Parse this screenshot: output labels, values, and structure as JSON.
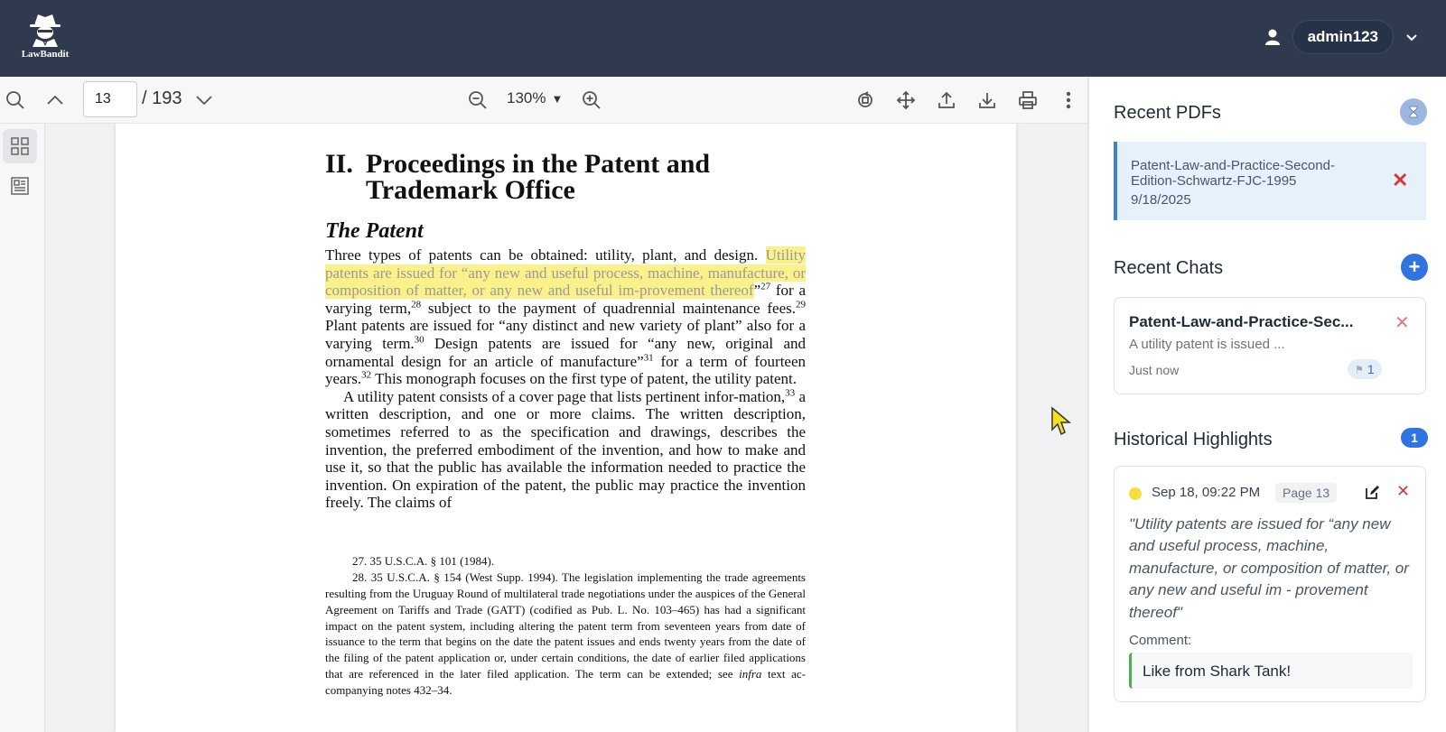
{
  "app": {
    "logo_text": "LawBandit",
    "username": "admin123"
  },
  "toolbar": {
    "page_value": "13",
    "page_total": "/ 193",
    "zoom": "130%"
  },
  "document": {
    "chapter_num": "II.",
    "chapter_line1": "Proceedings in the Patent and",
    "chapter_line2": "Trademark Office",
    "section": "The Patent",
    "p1_a": "Three types of patents can be obtained: utility, plant, and design.",
    "p1_hl": "Utility patents are issued for “any new and useful process, machine, manufacture, or composition of matter, or any new and useful im-provement thereof",
    "p1_b": "”",
    "p1_s27": "27",
    "p1_c": " for a varying term,",
    "p1_s28": "28",
    "p1_d": " subject to the payment of quadrennial maintenance fees.",
    "p1_s29": "29",
    "p1_e": " Plant patents are issued for “any distinct and new variety of plant” also for a varying term.",
    "p1_s30": "30",
    "p1_f": " Design patents are issued for “any new, original and ornamental design for an article of manufacture”",
    "p1_s31": "31",
    "p1_g": " for a term of fourteen years.",
    "p1_s32": "32",
    "p1_h": " This monograph focuses on the first type of patent, the utility patent.",
    "p2_a": "A utility patent consists of a cover page that lists pertinent infor-mation,",
    "p2_s33": "33",
    "p2_b": " a written description, and one or more claims. The written description, sometimes referred to as the specification and drawings, describes the invention, the preferred embodiment of the invention, and how to make and use it, so that the public has available the information needed to practice the invention. On expiration of the patent, the public may practice the invention freely. The claims of",
    "fn27": "27. 35 U.S.C.A. § 101 (1984).",
    "fn28": "28. 35 U.S.C.A. § 154 (West Supp. 1994). The legislation implementing the trade agreements resulting from the Uruguay Round of multilateral trade negotiations under the auspices of the General Agreement on Tariffs and Trade (GATT) (codified as Pub. L. No. 103–465) has had a significant impact on the patent system, including altering the patent term from seventeen years from date of issuance to the term that begins on the date the patent issues and ends twenty years from the date of the filing of the patent application or, under certain conditions, the date of earlier filed applications that are referenced in the later filed application. The term can be extended; see",
    "fn28_infra": "infra",
    "fn28_end": " text ac-companying notes 432–34."
  },
  "panel": {
    "recent_pdfs_title": "Recent PDFs",
    "pdf_name": "Patent-Law-and-Practice-Second-Edition-Schwartz-FJC-1995",
    "pdf_date": "9/18/2025",
    "recent_chats_title": "Recent Chats",
    "chat_title": "Patent-Law-and-Practice-Sec...",
    "chat_preview": "A utility patent is issued ...",
    "chat_time": "Just now",
    "chat_badge_count": "1",
    "highlights_title": "Historical Highlights",
    "highlights_count": "1",
    "hl_date": "Sep 18, 09:22 PM",
    "hl_page": "Page 13",
    "hl_quote": "\"Utility patents are issued for “any new and useful process, machine, manufacture, or composition of matter, or any new and useful im - provement thereof\"",
    "hl_comment_label": "Comment:",
    "hl_comment": "Like from Shark Tank!"
  },
  "colors": {
    "header_bg": "#2f3a4e",
    "highlight": "#fbf18a",
    "accent_blue": "#2f74e0",
    "danger": "#d33b3b",
    "comment_bar": "#4caf50"
  },
  "icons": [
    "spy-logo-icon",
    "user-icon",
    "chevron-down-icon",
    "search-icon",
    "chevron-up-icon",
    "zoom-out-icon",
    "zoom-in-icon",
    "rotate-icon",
    "move-icon",
    "upload-icon",
    "download-icon",
    "print-icon",
    "more-vertical-icon",
    "thumbnails-icon",
    "outline-icon",
    "hourglass-icon",
    "plus-icon",
    "close-icon",
    "edit-icon",
    "cursor-icon"
  ]
}
